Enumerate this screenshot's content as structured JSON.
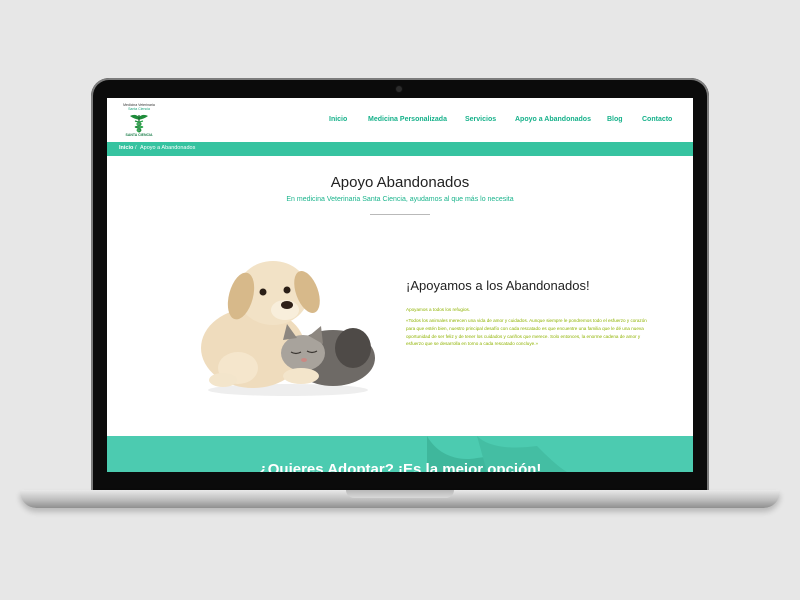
{
  "logo": {
    "line1": "Medicina Veterinaria",
    "line2": "Santa Ciencia",
    "line3": "SANTA CIENCIA",
    "icon": "caduceus-icon"
  },
  "nav": {
    "items": [
      {
        "label": "Inicio"
      },
      {
        "label": "Medicina Personalizada"
      },
      {
        "label": "Servicios"
      },
      {
        "label": "Apoyo a Abandonados"
      },
      {
        "label": "Blog"
      },
      {
        "label": "Contacto"
      }
    ]
  },
  "breadcrumb": {
    "home": "Inicio",
    "separator": "/",
    "current": "Apoyo a Abandonados"
  },
  "page": {
    "title": "Apoyo Abandonados",
    "subtitle": "En medicina Veterinaria Santa Ciencia, ayudamos al que más lo necesita"
  },
  "section": {
    "title": "¡Apoyamos a los Abandonados!",
    "lead": "Apoyamos a todos los refugios.",
    "body": "«Todos los animales merecen una vida de amor y cuidados. Aunque siempre le pondremos todo el esfuerzo y corazón para que estén bien, nuestro principal desafío con cada rescatado es que encuentre una familia que le dé una nueva oportunidad de ser feliz y de tener los cuidados y cariños que merece. Solo entonces, la enorme cadena de amor y esfuerzo que se desarrolla en torno a cada rescatado concluye.»"
  },
  "cta": {
    "text": "¿Quieres Adoptar? ¡Es la mejor opción!"
  },
  "colors": {
    "accent": "#16b18a",
    "bar": "#36c3a0",
    "cta": "#4ccbb0",
    "body_text": "#8fb300"
  }
}
